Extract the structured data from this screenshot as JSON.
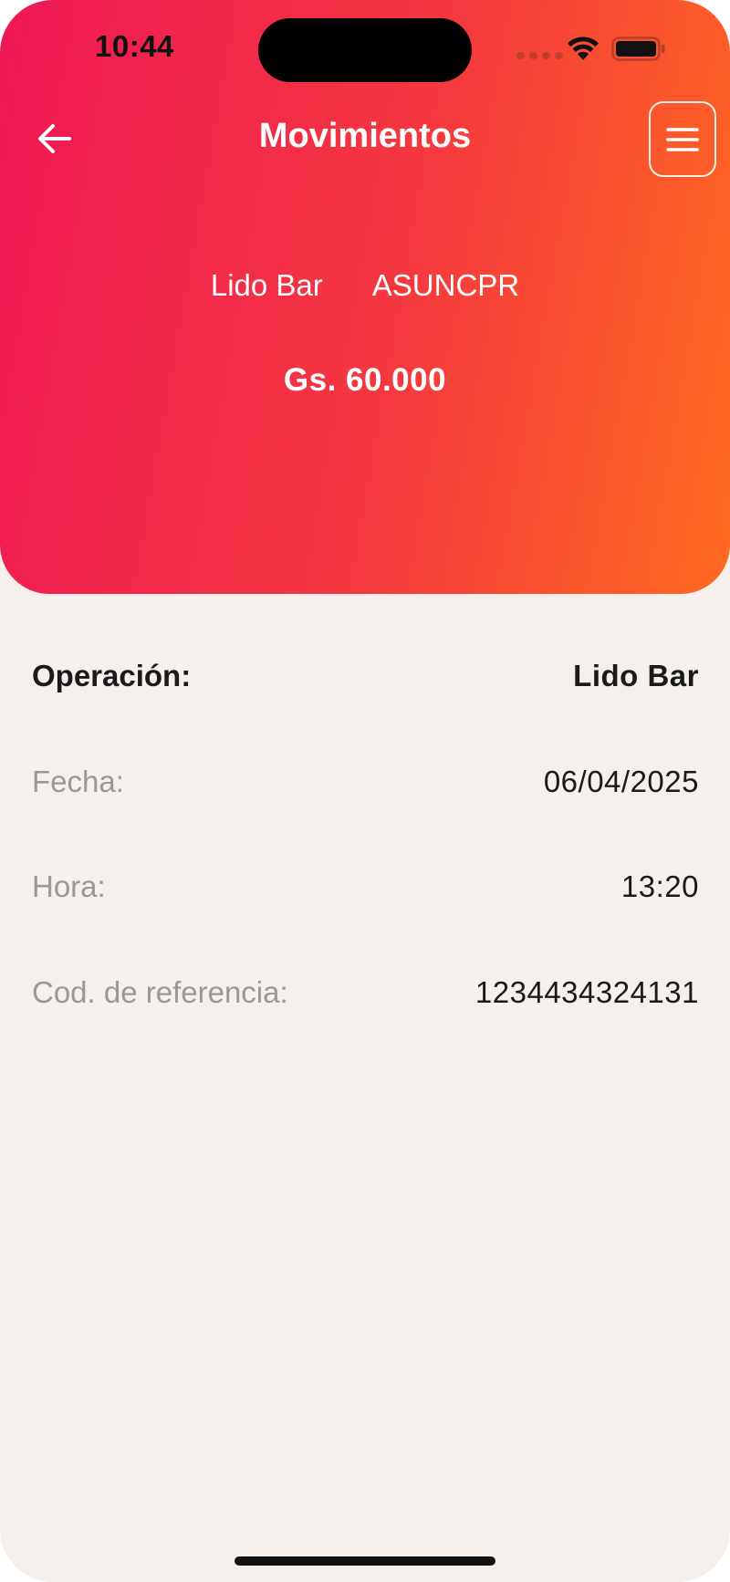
{
  "status_bar": {
    "time": "10:44"
  },
  "header": {
    "title": "Movimientos",
    "back_icon": "arrow-left-icon",
    "menu_icon": "hamburger-menu-icon",
    "merchant_name": "Lido Bar",
    "merchant_location": "ASUNCPR",
    "amount": "Gs. 60.000",
    "gradient_start": "#ee1756",
    "gradient_end": "#ff6a20"
  },
  "details": [
    {
      "label": "Operación:",
      "value": "Lido Bar"
    },
    {
      "label": "Fecha:",
      "value": "06/04/2025"
    },
    {
      "label": "Hora:",
      "value": "13:20"
    },
    {
      "label": "Cod. de referencia:",
      "value": "1234434324131"
    }
  ],
  "colors": {
    "background": "#f6f0ec",
    "label_muted": "#9b9795",
    "text_dark": "#1a1a1a"
  }
}
